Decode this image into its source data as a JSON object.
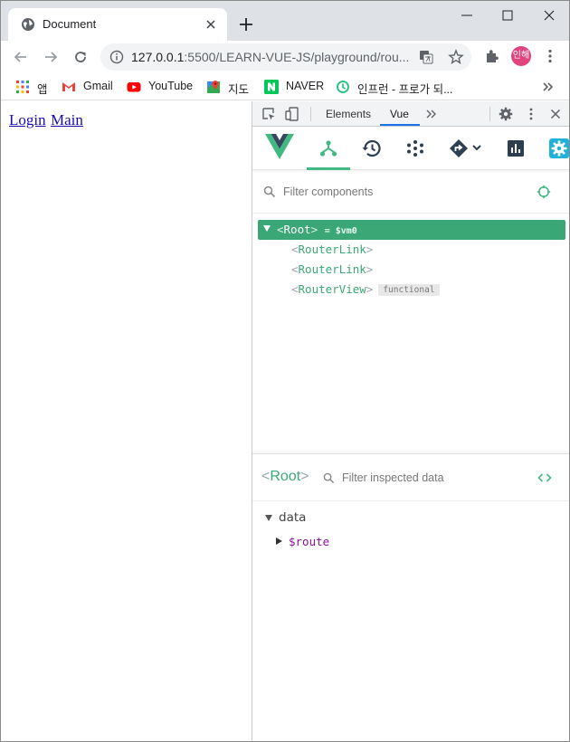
{
  "browser": {
    "tab_title": "Document",
    "url_host": "127.0.0.1",
    "url_path": ":5500/LEARN-VUE-JS/playground/rou...",
    "avatar_text": "인해"
  },
  "bookmarks": [
    {
      "label": "앱",
      "icon": "apps-grid-icon"
    },
    {
      "label": "Gmail",
      "icon": "gmail-icon"
    },
    {
      "label": "YouTube",
      "icon": "youtube-icon"
    },
    {
      "label": "지도",
      "icon": "maps-icon"
    },
    {
      "label": "NAVER",
      "icon": "naver-icon"
    },
    {
      "label": "인프런 - 프로가 되...",
      "icon": "inflearn-icon"
    }
  ],
  "page": {
    "links": [
      {
        "label": "Login"
      },
      {
        "label": "Main"
      }
    ]
  },
  "devtools": {
    "tabs": [
      {
        "label": "Elements"
      },
      {
        "label": "Vue"
      }
    ],
    "filter_placeholder": "Filter components",
    "tree": [
      {
        "name": "Root",
        "suffix": "= $vm0",
        "selected": true
      },
      {
        "name": "RouterLink"
      },
      {
        "name": "RouterLink"
      },
      {
        "name": "RouterView",
        "badge": "functional"
      }
    ],
    "inspector": {
      "title": "Root",
      "filter_placeholder": "Filter inspected data",
      "section": "data",
      "item": "$route"
    }
  },
  "colors": {
    "vue_green": "#42b983",
    "selected_row": "#3ba776",
    "link": "#1a0dab"
  }
}
